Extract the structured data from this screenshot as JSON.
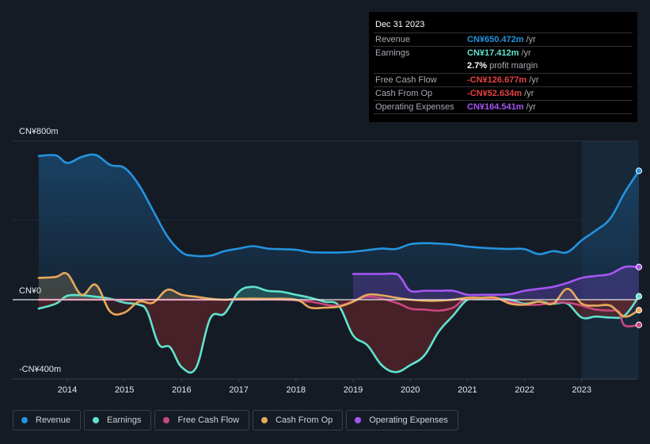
{
  "tooltip": {
    "date": "Dec 31 2023",
    "rows": [
      {
        "label": "Revenue",
        "value": "CN¥650.472m",
        "unit": " /yr",
        "color": "#2394df"
      },
      {
        "label": "Earnings",
        "value": "CN¥17.412m",
        "unit": " /yr",
        "color": "#5fe3d0"
      },
      {
        "label": "",
        "value": "2.7%",
        "unit": " profit margin",
        "color": "#ffffff"
      },
      {
        "label": "Free Cash Flow",
        "value": "-CN¥126.677m",
        "unit": " /yr",
        "color": "#e64141"
      },
      {
        "label": "Cash From Op",
        "value": "-CN¥52.634m",
        "unit": " /yr",
        "color": "#e64141"
      },
      {
        "label": "Operating Expenses",
        "value": "CN¥164.541m",
        "unit": " /yr",
        "color": "#a855f7"
      }
    ]
  },
  "legend": [
    {
      "label": "Revenue",
      "color": "#2394df"
    },
    {
      "label": "Earnings",
      "color": "#5fe3d0"
    },
    {
      "label": "Free Cash Flow",
      "color": "#c9467f"
    },
    {
      "label": "Cash From Op",
      "color": "#e8a95b"
    },
    {
      "label": "Operating Expenses",
      "color": "#a855f7"
    }
  ],
  "chart_data": {
    "type": "line",
    "title": "",
    "xlabel": "",
    "ylabel": "",
    "y_tick_labels": [
      "CN¥800m",
      "CN¥0",
      "-CN¥400m"
    ],
    "y_ticks": [
      800,
      0,
      -400
    ],
    "ylim": [
      -400,
      800
    ],
    "xlim": [
      2013.5,
      2024.0
    ],
    "x_tick_labels": [
      "2014",
      "2015",
      "2016",
      "2017",
      "2018",
      "2019",
      "2020",
      "2021",
      "2022",
      "2023"
    ],
    "x_ticks": [
      2014,
      2015,
      2016,
      2017,
      2018,
      2019,
      2020,
      2021,
      2022,
      2023
    ],
    "highlight_range": [
      2023.0,
      2024.0
    ],
    "grid": true,
    "legend_position": "bottom",
    "series": [
      {
        "name": "Revenue",
        "color": "#2394df",
        "fill": true,
        "x": [
          2013.5,
          2013.8,
          2014.0,
          2014.25,
          2014.5,
          2014.75,
          2015.0,
          2015.25,
          2015.5,
          2015.75,
          2016.0,
          2016.2,
          2016.5,
          2016.75,
          2017.0,
          2017.25,
          2017.5,
          2017.75,
          2018.0,
          2018.25,
          2018.5,
          2018.75,
          2019.0,
          2019.25,
          2019.5,
          2019.75,
          2020.0,
          2020.25,
          2020.5,
          2020.75,
          2021.0,
          2021.25,
          2021.5,
          2021.75,
          2022.0,
          2022.25,
          2022.5,
          2022.75,
          2023.0,
          2023.25,
          2023.5,
          2023.75,
          2024.0
        ],
        "y": [
          725,
          728,
          690,
          720,
          730,
          680,
          665,
          580,
          450,
          320,
          240,
          222,
          222,
          245,
          258,
          270,
          258,
          255,
          252,
          240,
          238,
          238,
          242,
          250,
          258,
          256,
          280,
          285,
          283,
          278,
          268,
          262,
          258,
          256,
          255,
          230,
          245,
          240,
          300,
          350,
          410,
          540,
          650
        ]
      },
      {
        "name": "Earnings",
        "color": "#5fe3d0",
        "fill": true,
        "x": [
          2013.5,
          2013.8,
          2014.0,
          2014.25,
          2014.5,
          2014.75,
          2015.0,
          2015.25,
          2015.4,
          2015.6,
          2015.8,
          2016.0,
          2016.25,
          2016.5,
          2016.75,
          2017.0,
          2017.25,
          2017.5,
          2017.75,
          2018.0,
          2018.25,
          2018.5,
          2018.75,
          2019.0,
          2019.25,
          2019.5,
          2019.75,
          2020.0,
          2020.25,
          2020.5,
          2020.75,
          2021.0,
          2021.25,
          2021.5,
          2021.75,
          2022.0,
          2022.25,
          2022.5,
          2022.75,
          2023.0,
          2023.25,
          2023.5,
          2023.75,
          2024.0
        ],
        "y": [
          -45,
          -20,
          20,
          22,
          15,
          5,
          -15,
          -25,
          -60,
          -225,
          -240,
          -340,
          -345,
          -95,
          -70,
          40,
          65,
          45,
          40,
          25,
          10,
          -10,
          -30,
          -180,
          -230,
          -330,
          -365,
          -330,
          -280,
          -160,
          -80,
          0,
          5,
          5,
          0,
          -20,
          -10,
          -20,
          -20,
          -90,
          -85,
          -90,
          -80,
          17
        ]
      },
      {
        "name": "Free Cash Flow",
        "color": "#c9467f",
        "fill": false,
        "x": [
          2013.5,
          2014.0,
          2015.0,
          2016.0,
          2017.0,
          2017.75,
          2018.25,
          2018.75,
          2019.25,
          2019.75,
          2020.0,
          2020.25,
          2020.5,
          2020.75,
          2021.0,
          2021.5,
          2021.75,
          2022.0,
          2022.25,
          2022.5,
          2022.75,
          2023.0,
          2023.25,
          2023.5,
          2023.65,
          2023.75,
          2024.0
        ],
        "y": [
          0,
          0,
          0,
          0,
          0,
          0,
          -10,
          -30,
          15,
          -15,
          -45,
          -50,
          -55,
          -40,
          5,
          5,
          -10,
          -25,
          -25,
          -15,
          -15,
          -30,
          -50,
          -55,
          -60,
          -130,
          -127
        ]
      },
      {
        "name": "Cash From Op",
        "color": "#e8a95b",
        "fill": true,
        "x": [
          2013.5,
          2013.8,
          2014.0,
          2014.25,
          2014.5,
          2014.75,
          2015.0,
          2015.25,
          2015.5,
          2015.75,
          2016.0,
          2016.25,
          2016.5,
          2016.75,
          2017.0,
          2017.5,
          2018.0,
          2018.25,
          2018.5,
          2018.75,
          2019.0,
          2019.25,
          2019.5,
          2019.75,
          2020.0,
          2020.25,
          2020.5,
          2020.75,
          2021.0,
          2021.25,
          2021.5,
          2021.75,
          2022.0,
          2022.25,
          2022.5,
          2022.75,
          2023.0,
          2023.25,
          2023.5,
          2023.75,
          2024.0
        ],
        "y": [
          110,
          115,
          130,
          25,
          75,
          -60,
          -65,
          -10,
          -15,
          50,
          25,
          15,
          5,
          0,
          5,
          5,
          0,
          -40,
          -40,
          -35,
          -10,
          25,
          22,
          10,
          0,
          -5,
          -5,
          0,
          10,
          10,
          10,
          -20,
          -25,
          -10,
          -20,
          55,
          -20,
          -30,
          -30,
          -85,
          -53
        ]
      },
      {
        "name": "Operating Expenses",
        "color": "#a855f7",
        "fill": true,
        "x": [
          2019.0,
          2019.25,
          2019.5,
          2019.75,
          2019.85,
          2020.0,
          2020.25,
          2020.5,
          2020.75,
          2021.0,
          2021.25,
          2021.5,
          2021.75,
          2022.0,
          2022.25,
          2022.5,
          2022.75,
          2023.0,
          2023.25,
          2023.5,
          2023.75,
          2024.0
        ],
        "y": [
          130,
          130,
          130,
          130,
          105,
          45,
          45,
          45,
          45,
          25,
          25,
          25,
          28,
          45,
          55,
          65,
          85,
          110,
          120,
          130,
          165,
          165
        ]
      }
    ]
  }
}
